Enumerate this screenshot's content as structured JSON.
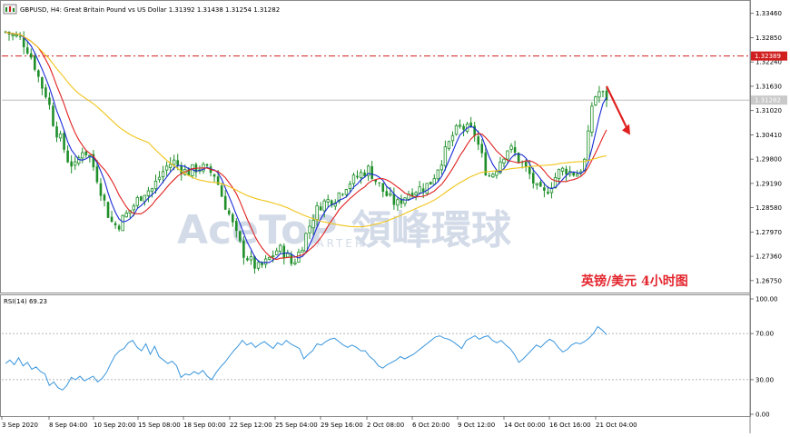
{
  "header": {
    "symbol_line": "GBPUSD, H4:  Great Britain Pound vs US Dollar  1.31392 1.31438 1.31254 1.31282"
  },
  "indicator": {
    "label": "RSI(14) 69.23"
  },
  "caption": {
    "text": "英镑/美元  4小时图"
  },
  "watermark": {
    "text": "AceToP 領峰環球",
    "sub": "MARTER"
  },
  "colors": {
    "bull": "#1f8f2a",
    "bear": "#1f8f2a",
    "ma_fast": "#1a2bd6",
    "ma_mid": "#e0201f",
    "ma_slow": "#f0c419",
    "rsi": "#3a96dd",
    "level_line": "#d11f1f",
    "arrow": "#e0201f",
    "grid_dotted": "#9aa0a6"
  },
  "icons": {
    "chart_icon": "chart-window-icon"
  },
  "chart_data": [
    {
      "type": "candlestick",
      "title": "GBPUSD, H4:  Great Britain Pound vs US Dollar  1.31392 1.31438 1.31254 1.31282",
      "ylim": [
        1.2645,
        1.3375
      ],
      "y_ticks": [
        "1.33460",
        "1.32850",
        "1.32240",
        "1.31630",
        "1.31020",
        "1.30410",
        "1.29800",
        "1.29190",
        "1.28580",
        "1.27970",
        "1.27360",
        "1.26750"
      ],
      "x_ticks": [
        "3 Sep 2020",
        "8 Sep 04:00",
        "10 Sep 20:00",
        "15 Sep 08:00",
        "18 Sep 00:00",
        "22 Sep 12:00",
        "25 Sep 04:00",
        "29 Sep 16:00",
        "2 Oct 08:00",
        "6 Oct 20:00",
        "9 Oct 12:00",
        "14 Oct 00:00",
        "16 Oct 16:00",
        "21 Oct 04:00"
      ],
      "horizontal_levels": [
        {
          "value": 1.32389,
          "label": "1.32389",
          "style": "dash-dot"
        },
        {
          "value": 1.31282,
          "label": "1.31282",
          "style": "solid",
          "role": "current-price"
        }
      ],
      "close_path": [
        1.33,
        1.329,
        1.3285,
        1.3262,
        1.3225,
        1.317,
        1.3135,
        1.306,
        1.3025,
        1.2975,
        1.296,
        1.3005,
        1.299,
        1.294,
        1.288,
        1.2825,
        1.281,
        1.2835,
        1.2855,
        1.288,
        1.29,
        1.2905,
        1.2935,
        1.296,
        1.2975,
        1.296,
        1.2945,
        1.2955,
        1.296,
        1.295,
        1.294,
        1.2885,
        1.284,
        1.279,
        1.2745,
        1.2725,
        1.2705,
        1.2715,
        1.2735,
        1.2755,
        1.2745,
        1.2715,
        1.2745,
        1.279,
        1.2835,
        1.2865,
        1.2875,
        1.288,
        1.29,
        1.292,
        1.293,
        1.2945,
        1.2955,
        1.2925,
        1.29,
        1.288,
        1.2865,
        1.2885,
        1.29,
        1.2905,
        1.291,
        1.2925,
        1.2965,
        1.3,
        1.304,
        1.306,
        1.3055,
        1.305,
        1.2995,
        1.2935,
        1.295,
        1.2985,
        1.301,
        1.299,
        1.2965,
        1.294,
        1.2905,
        1.289,
        1.2915,
        1.2945,
        1.2955,
        1.2945,
        1.2945,
        1.298,
        1.313,
        1.315,
        1.3128
      ],
      "moving_averages": [
        {
          "role": "fast",
          "color": "#1a2bd6"
        },
        {
          "role": "mid",
          "color": "#e0201f"
        },
        {
          "role": "slow",
          "color": "#f0c419"
        }
      ],
      "annotation": "arrow pointing down-right from latest high"
    },
    {
      "type": "line",
      "title": "RSI(14) 69.23",
      "ylim": [
        0,
        100
      ],
      "y_ticks": [
        "100.00",
        "70.00",
        "30.00",
        "0.00"
      ],
      "levels": [
        70,
        30
      ],
      "series": [
        {
          "name": "RSI(14)",
          "values": [
            44,
            47,
            43,
            49,
            42,
            45,
            39,
            41,
            37,
            35,
            25,
            28,
            23,
            21,
            25,
            32,
            30,
            33,
            29,
            31,
            33,
            28,
            31,
            36,
            44,
            51,
            55,
            57,
            62,
            64,
            58,
            55,
            61,
            52,
            59,
            50,
            47,
            44,
            46,
            42,
            32,
            35,
            34,
            37,
            35,
            38,
            33,
            30,
            36,
            41,
            45,
            50,
            55,
            59,
            64,
            60,
            62,
            58,
            61,
            63,
            60,
            57,
            62,
            60,
            64,
            61,
            59,
            57,
            48,
            52,
            55,
            61,
            60,
            63,
            65,
            66,
            63,
            60,
            58,
            60,
            58,
            55,
            55,
            50,
            47,
            42,
            40,
            43,
            45,
            47,
            50,
            48,
            50,
            52,
            55,
            58,
            61,
            64,
            67,
            68,
            66,
            65,
            63,
            60,
            57,
            64,
            66,
            68,
            65,
            67,
            68,
            64,
            62,
            64,
            60,
            57,
            52,
            45,
            48,
            52,
            56,
            60,
            58,
            62,
            65,
            63,
            58,
            54,
            56,
            60,
            62,
            61,
            63,
            66,
            70,
            76,
            73,
            69
          ]
        }
      ]
    }
  ]
}
